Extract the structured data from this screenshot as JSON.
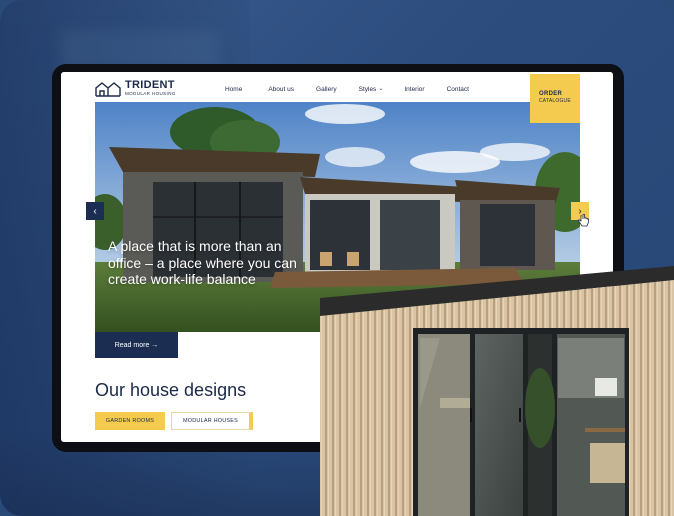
{
  "site": {
    "logo_title": "TRIDENT",
    "logo_subtitle": "MODULAR HOUSING"
  },
  "nav": {
    "items": [
      {
        "label": "Home"
      },
      {
        "label": "About us"
      },
      {
        "label": "Gallery"
      },
      {
        "label": "Styles",
        "has_dropdown": true
      },
      {
        "label": "Interior"
      },
      {
        "label": "Contact"
      }
    ],
    "order_title": "ORDER",
    "order_subtitle": "CATALOGUE"
  },
  "hero": {
    "headline": "A place that is more than an office – a place where you can create work-life balance",
    "read_more": "Read more →",
    "prev_icon": "chevron-left-icon",
    "next_icon": "chevron-right-icon"
  },
  "designs": {
    "title": "Our house designs",
    "tabs": [
      {
        "label": "GARDEN ROOMS",
        "active": true
      },
      {
        "label": "MODULAR HOUSES",
        "active": false
      }
    ]
  },
  "colors": {
    "accent": "#f4cb4e",
    "navy": "#1b2e52",
    "background": "#2d4d7f"
  }
}
